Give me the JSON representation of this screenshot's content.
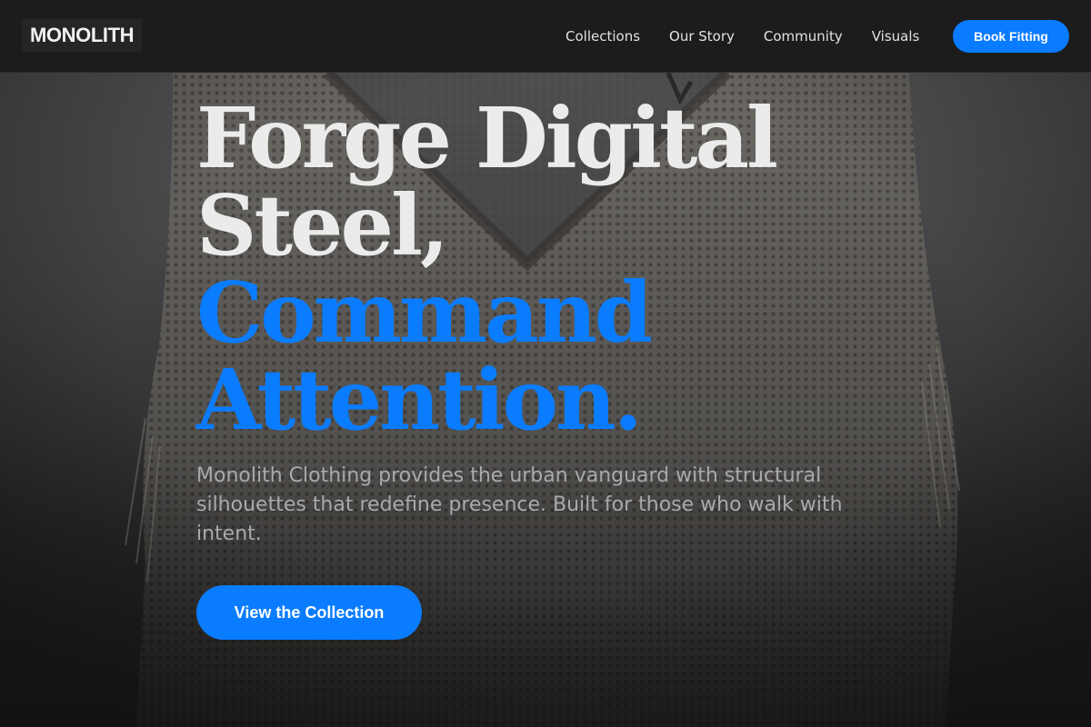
{
  "brand": {
    "logo_text": "MONOLITH"
  },
  "nav": {
    "items": [
      {
        "label": "Collections"
      },
      {
        "label": "Our Story"
      },
      {
        "label": "Community"
      },
      {
        "label": "Visuals"
      }
    ],
    "cta_label": "Book Fitting"
  },
  "hero": {
    "title_line_1": "Forge Digital",
    "title_line_2": "Steel,",
    "title_line_3": "Command",
    "title_line_4": "Attention.",
    "description": "Monolith Clothing provides the urban vanguard with structural silhouettes that redefine presence. Built for those who walk with intent.",
    "cta_label": "View the Collection",
    "background_image": "knitted-sweater-vest-photo"
  },
  "colors": {
    "accent": "#0a7cff",
    "header_bg": "#1c1c1d",
    "page_bg": "#1b1b1c",
    "title_light": "#ebebeb",
    "body_text": "#a9a9ae"
  }
}
